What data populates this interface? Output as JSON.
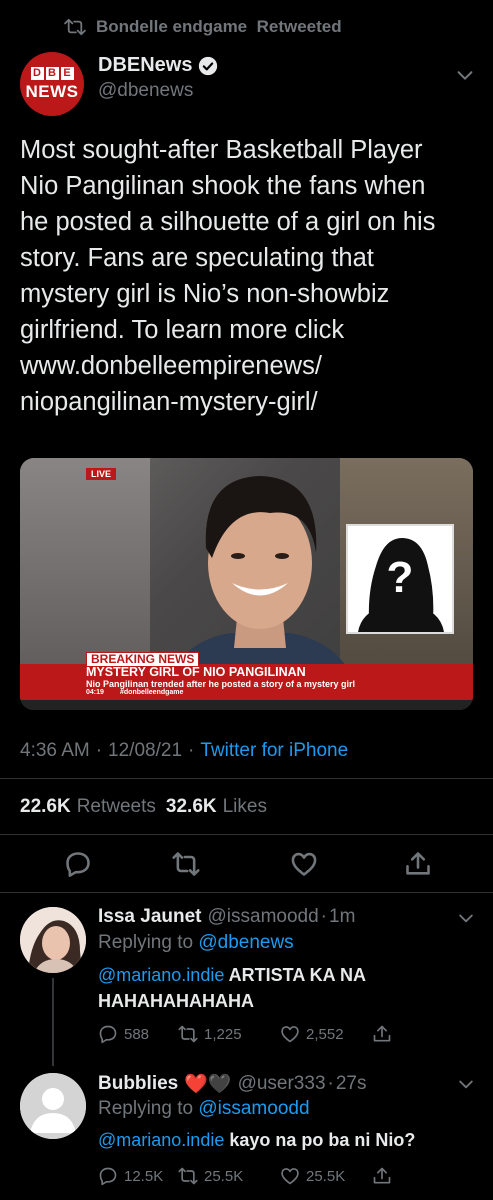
{
  "retweet_header": {
    "text": "Bondelle endgame  Retweeted"
  },
  "author": {
    "name": "DBENews",
    "handle": "@dbenews",
    "logo_letters": [
      "D",
      "B",
      "E"
    ],
    "logo_word": "NEWS",
    "brand_color": "#bb1919"
  },
  "tweet": {
    "lines": [
      "Most sought-after Basketball Player",
      "Nio Pangilinan shook the fans when",
      "he posted a silhouette of a girl on his",
      "story. Fans are speculating that",
      "mystery girl is Nio’s non-showbiz",
      "girlfriend. To learn more click",
      "www.donbelleempirenews/",
      "niopangilinan-mystery-girl/"
    ]
  },
  "media": {
    "live_label": "LIVE",
    "breaking_label": "BREAKING NEWS",
    "headline": "MYSTERY GIRL OF NIO PANGILINAN",
    "subline": "Nio Pangilinan trended after he posted a story of a mystery girl",
    "clock": "04:19",
    "hashtag": "#donbelleendgame"
  },
  "meta": {
    "time": "4:36 AM",
    "date": "12/08/21",
    "dot": "·",
    "source": "Twitter for iPhone"
  },
  "stats": {
    "retweets_count": "22.6K",
    "retweets_label": "Retweets",
    "likes_count": "32.6K",
    "likes_label": "Likes"
  },
  "actions": {
    "icons": [
      "reply-icon",
      "retweet-icon",
      "like-icon",
      "share-icon"
    ]
  },
  "replies": [
    {
      "name": "Issa Jaunet",
      "handle": "@issamoodd",
      "dot": "·",
      "time": "1m",
      "replying_label": "Replying to",
      "replying_to": "@dbenews",
      "mention": "@mariano.indie",
      "text_after_mention": " ARTISTA KA NA",
      "text_line2": "HAHAHAHAHAHA",
      "reply_count": "588",
      "retweet_count": "1,225",
      "like_count": "2,552"
    },
    {
      "name": "Bubblies",
      "emoji": "❤️🖤",
      "handle": "@user333",
      "dot": "·",
      "time": "27s",
      "replying_label": "Replying to",
      "replying_to": "@issamoodd",
      "mention": "@mariano.indie",
      "text_after_mention": " kayo na po ba ni Nio?",
      "reply_count": "12.5K",
      "retweet_count": "25.5K",
      "like_count": "25.5K"
    }
  ]
}
